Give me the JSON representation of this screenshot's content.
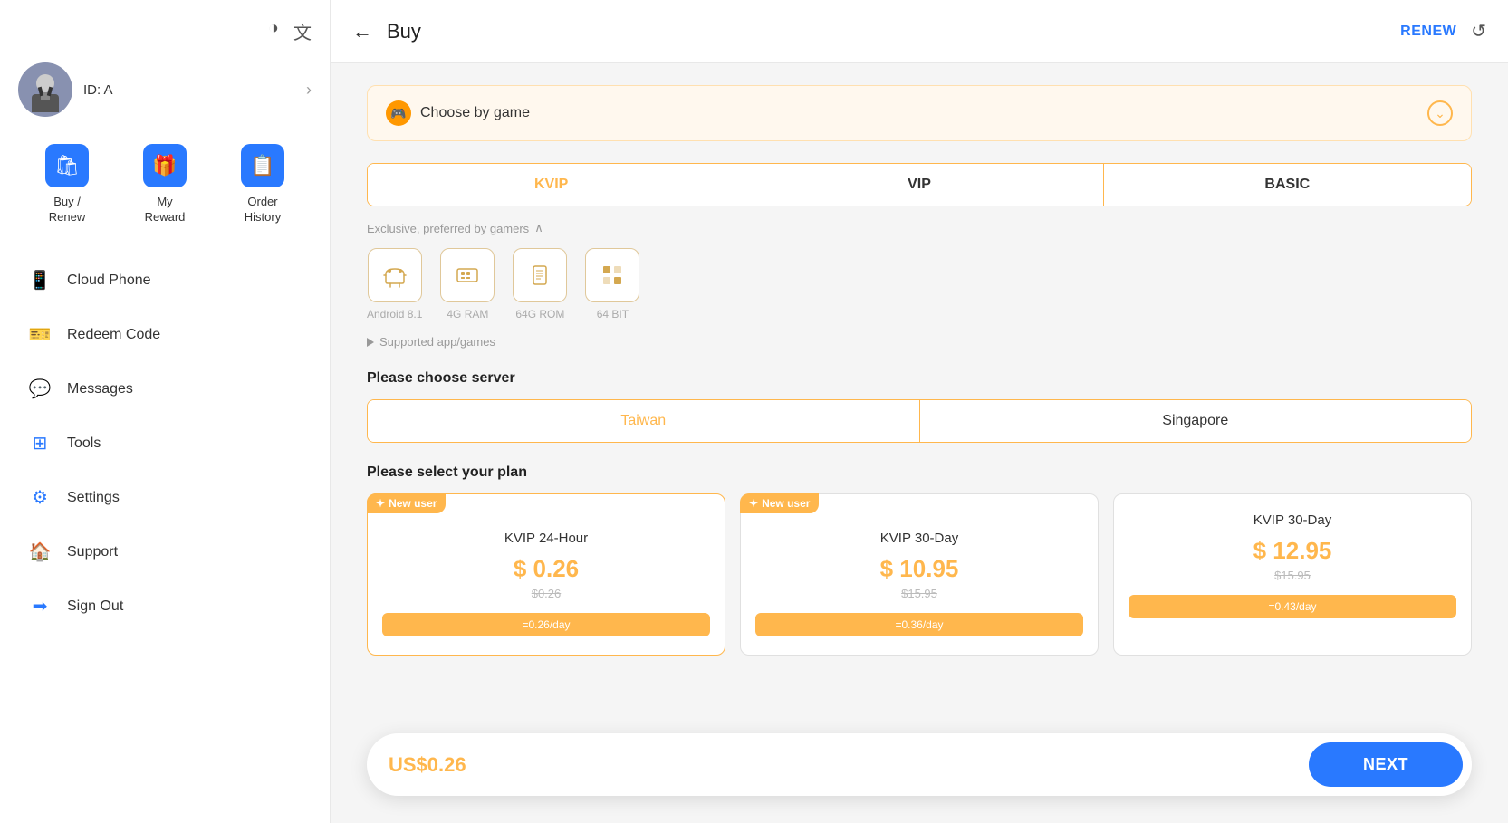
{
  "sidebar": {
    "theme_icon": "◑",
    "translate_icon": "文",
    "profile": {
      "id_label": "ID: A",
      "arrow": "›"
    },
    "quick_actions": [
      {
        "id": "buy-renew",
        "label": "Buy /\nRenew",
        "icon": "🛍"
      },
      {
        "id": "my-reward",
        "label": "My\nReward",
        "icon": "🎁"
      },
      {
        "id": "order-history",
        "label": "Order\nHistory",
        "icon": "📋"
      }
    ],
    "nav_items": [
      {
        "id": "cloud-phone",
        "label": "Cloud Phone",
        "icon": "📱"
      },
      {
        "id": "redeem-code",
        "label": "Redeem Code",
        "icon": "🎫"
      },
      {
        "id": "messages",
        "label": "Messages",
        "icon": "💬"
      },
      {
        "id": "tools",
        "label": "Tools",
        "icon": "⊞"
      },
      {
        "id": "settings",
        "label": "Settings",
        "icon": "⚙"
      },
      {
        "id": "support",
        "label": "Support",
        "icon": "🏠"
      },
      {
        "id": "sign-out",
        "label": "Sign Out",
        "icon": "➡"
      }
    ]
  },
  "header": {
    "back_label": "←",
    "title": "Buy",
    "renew_label": "RENEW",
    "refresh_icon": "↺"
  },
  "main": {
    "game_banner": {
      "icon": "🎮",
      "text": "Choose by game",
      "chevron": "⌄"
    },
    "tier_tabs": [
      {
        "id": "kvip",
        "label": "KVIP",
        "active": true
      },
      {
        "id": "vip",
        "label": "VIP",
        "active": false
      },
      {
        "id": "basic",
        "label": "BASIC",
        "active": false
      }
    ],
    "exclusive_label": "Exclusive, preferred by gamers",
    "specs": [
      {
        "id": "android",
        "icon": "🤖",
        "label": "Android 8.1"
      },
      {
        "id": "ram",
        "icon": "⬛",
        "label": "4G RAM"
      },
      {
        "id": "rom",
        "icon": "▦",
        "label": "64G ROM"
      },
      {
        "id": "bit",
        "icon": "⬜",
        "label": "64 BIT"
      }
    ],
    "supported_games_label": "Supported app/games",
    "server_section_label": "Please choose server",
    "servers": [
      {
        "id": "taiwan",
        "label": "Taiwan",
        "active": true
      },
      {
        "id": "singapore",
        "label": "Singapore",
        "active": false
      }
    ],
    "plan_section_label": "Please select your plan",
    "plans": [
      {
        "id": "kvip-24h-new",
        "new_user": true,
        "new_user_label": "New user",
        "name": "KVIP 24-Hour",
        "price": "$ 0.26",
        "original_price": "$0.26",
        "bottom_text": "=0.26/day",
        "selected": true
      },
      {
        "id": "kvip-30d-new",
        "new_user": true,
        "new_user_label": "New user",
        "name": "KVIP 30-Day",
        "price": "$ 10.95",
        "original_price": "$15.95",
        "bottom_text": "=0.36/day",
        "selected": false
      },
      {
        "id": "kvip-30d",
        "new_user": false,
        "name": "KVIP 30-Day",
        "price": "$ 12.95",
        "original_price": "$15.95",
        "bottom_text": "=0.43/day",
        "selected": false
      }
    ],
    "bottom_bar": {
      "price": "US$0.26",
      "next_label": "NEXT"
    }
  }
}
